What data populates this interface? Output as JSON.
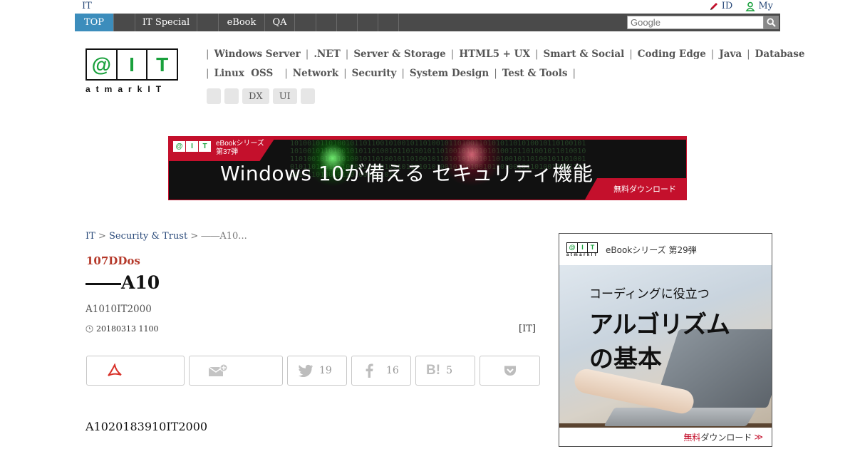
{
  "topstrip": {
    "site": "IT",
    "links": [
      {
        "label": "ID",
        "icon": "pencil-icon"
      },
      {
        "label": "My",
        "icon": "user-icon"
      }
    ]
  },
  "nav": {
    "items": [
      "TOP",
      "",
      "IT Special",
      "",
      "eBook",
      "QA",
      "",
      "",
      "",
      "",
      ""
    ],
    "active": 0,
    "search_placeholder": "Google"
  },
  "logo": {
    "cells": [
      "@",
      "I",
      "T"
    ],
    "wordmark": "atmarkIT"
  },
  "categories": {
    "row1": [
      "Windows Server",
      ".NET",
      "Server & Storage",
      "HTML5 + UX",
      "Smart & Social",
      "Coding Edge",
      "Java",
      "Database"
    ],
    "row2": [
      "Linux  OSS",
      "Network",
      "Security",
      "System Design",
      "Test & Tools"
    ],
    "chips": [
      "",
      "",
      "DX",
      "UI",
      ""
    ]
  },
  "banner": {
    "logo_cells": [
      "@",
      "I",
      "T"
    ],
    "tag_line1": "eBookシリーズ",
    "tag_line2": "第37弾",
    "headline": "Windows 10が備える セキュリティ機能",
    "cta": "無料ダウンロード",
    "digits": "1010010110100101101100101001011010010110100110101011010100101101001011010010110100101011010010110100101101001011010101001011010010110100101101001010110100101101001011010010110101010010110100101101001011010010101101001011010010110100101101010100101101001011010010110100101011010010110100101101001011010"
  },
  "breadcrumb": {
    "items": [
      "IT",
      "Security & Trust",
      "――A10..."
    ],
    "separator": ">"
  },
  "article": {
    "kicker": "107DDos",
    "title": "――A10",
    "subtitle": "A1010IT2000",
    "date": "20180313 1100",
    "author": "[IT]",
    "lead": "A1020183910IT2000"
  },
  "share": {
    "pdf_icon": "pdf-icon",
    "mail_icon": "mail-add-icon",
    "twitter_count": "19",
    "facebook_count": "16",
    "hatena_count": "5",
    "hatena_label": "B!",
    "pocket_icon": "pocket-icon"
  },
  "sidead": {
    "logo_cells": [
      "@",
      "I",
      "T"
    ],
    "wordmark": "atmarkIT",
    "series": "eBookシリーズ 第29弾",
    "line1": "コーディングに役立つ",
    "line2": "アルゴリズム",
    "line3": "の基本",
    "cta_red": "無料",
    "cta_rest": "ダウンロード",
    "cta_arrow": "≫"
  },
  "colors": {
    "nav_bg": "#4a4a4a",
    "nav_active": "#3c8dbc",
    "brand_green": "#19a03c",
    "kicker_red": "#b5392a",
    "banner_red": "#c4102c",
    "link_blue": "#2a4a7a"
  }
}
